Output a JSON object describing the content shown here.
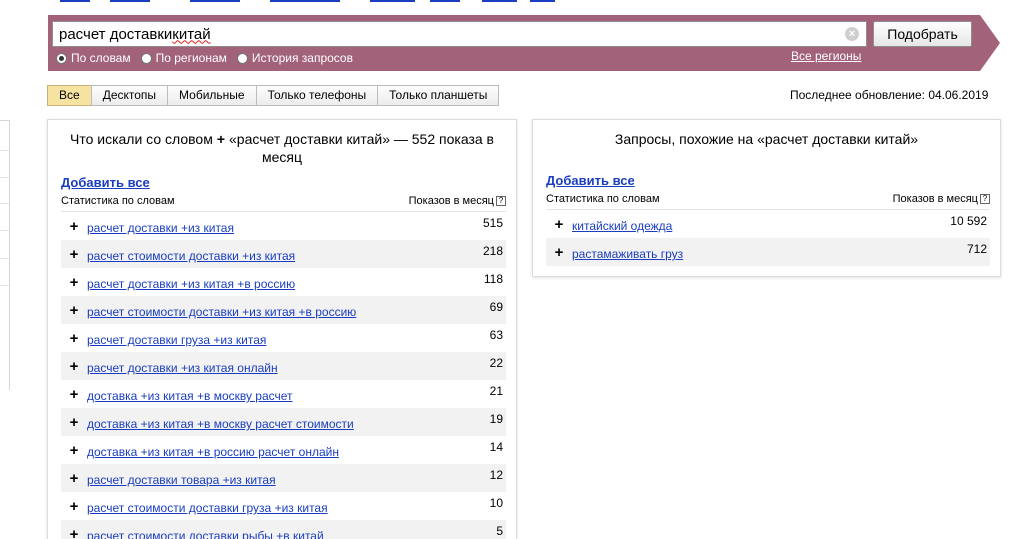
{
  "search": {
    "query_typed": "расчет доставки ",
    "query_underlined": "китай",
    "submit_label": "Подобрать",
    "clear_symbol": "×",
    "modes": [
      {
        "label": "По словам",
        "selected": true
      },
      {
        "label": "По регионам",
        "selected": false
      },
      {
        "label": "История запросов",
        "selected": false
      }
    ],
    "regions_link": "Все регионы"
  },
  "tabs": [
    {
      "label": "Все",
      "active": true
    },
    {
      "label": "Десктопы",
      "active": false
    },
    {
      "label": "Мобильные",
      "active": false
    },
    {
      "label": "Только телефоны",
      "active": false
    },
    {
      "label": "Только планшеты",
      "active": false
    }
  ],
  "last_update": "Последнее обновление: 04.06.2019",
  "left_panel": {
    "title_before": "Что искали со словом",
    "title_plus": "+",
    "title_after": "«расчет доставки китай» — 552 показа в месяц",
    "add_all": "Добавить все",
    "col_phrase": "Статистика по словам",
    "col_count": "Показов в месяц",
    "help": "?",
    "rows": [
      {
        "phrase": "расчет доставки +из китая",
        "count": "515"
      },
      {
        "phrase": "расчет стоимости доставки +из китая",
        "count": "218"
      },
      {
        "phrase": "расчет доставки +из китая +в россию",
        "count": "118"
      },
      {
        "phrase": "расчет стоимости доставки +из китая +в россию",
        "count": "69"
      },
      {
        "phrase": "расчет доставки груза +из китая",
        "count": "63"
      },
      {
        "phrase": "расчет доставки +из китая онлайн",
        "count": "22"
      },
      {
        "phrase": "доставка +из китая +в москву расчет",
        "count": "21"
      },
      {
        "phrase": "доставка +из китая +в москву расчет стоимости",
        "count": "19"
      },
      {
        "phrase": "доставка +из китая +в россию расчет онлайн",
        "count": "14"
      },
      {
        "phrase": "расчет доставки товара +из китая",
        "count": "12"
      },
      {
        "phrase": "расчет стоимости доставки груза +из китая",
        "count": "10"
      },
      {
        "phrase": "расчет стоимости доставки рыбы +в китай",
        "count": "5"
      }
    ]
  },
  "right_panel": {
    "title": "Запросы, похожие на «расчет доставки китай»",
    "add_all": "Добавить все",
    "col_phrase": "Статистика по словам",
    "col_count": "Показов в месяц",
    "help": "?",
    "rows": [
      {
        "phrase": "китайский одежда",
        "count": "10 592"
      },
      {
        "phrase": "растамаживать груз",
        "count": "712"
      }
    ]
  },
  "plus_symbol": "+",
  "colors": {
    "banner": "#a2627a",
    "link": "#1a3dc1",
    "active_tab": "#f7e3a1",
    "row_alt": "#f2f2f2"
  }
}
